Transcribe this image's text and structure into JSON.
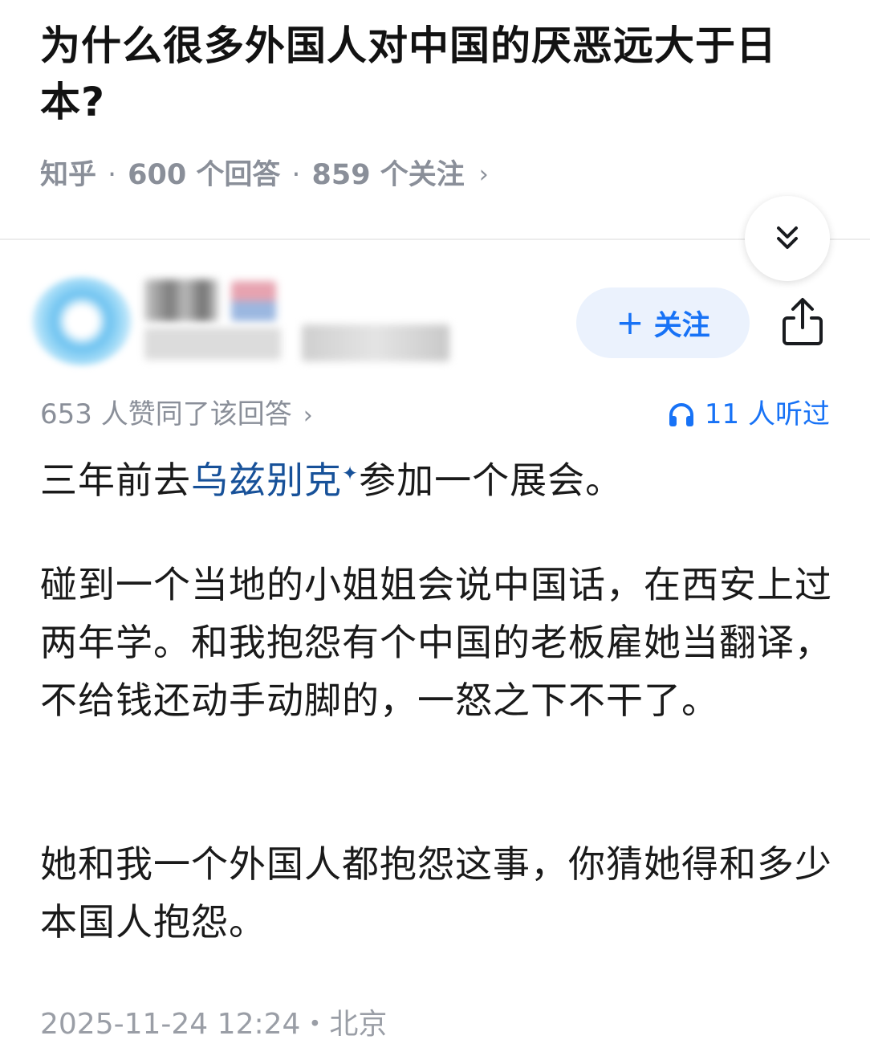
{
  "question": {
    "title": "为什么很多外国人对中国的厌恶远大于日本?",
    "source": "知乎",
    "answers": "600 个回答",
    "followers": "859 个关注",
    "separator": "·",
    "chevron": "›"
  },
  "toolbar": {
    "collapse_icon": "double-chevron-down-icon",
    "follow_label": "关注",
    "follow_plus": "+",
    "share_icon": "share-icon"
  },
  "answer": {
    "upvote_text": "653 人赞同了该回答",
    "upvote_chevron": "›",
    "listen_text": "11 人听过",
    "p1_before": "三年前去",
    "p1_link": "乌兹别克",
    "p1_link_mark": "✦",
    "p1_after": "参加一个展会。",
    "p2": "碰到一个当地的小姐姐会说中国话，在西安上过两年学。和我抱怨有个中国的老板雇她当翻译，不给钱还动手动脚的，一怒之下不干了。",
    "p3": "她和我一个外国人都抱怨这事，你猜她得和多少本国人抱怨。",
    "footer": "2025-11-24 12:24・北京"
  },
  "colors": {
    "accent": "#1772f6",
    "link": "#175199",
    "meta": "#8a8f99",
    "follow_bg": "#ebf2fd"
  }
}
